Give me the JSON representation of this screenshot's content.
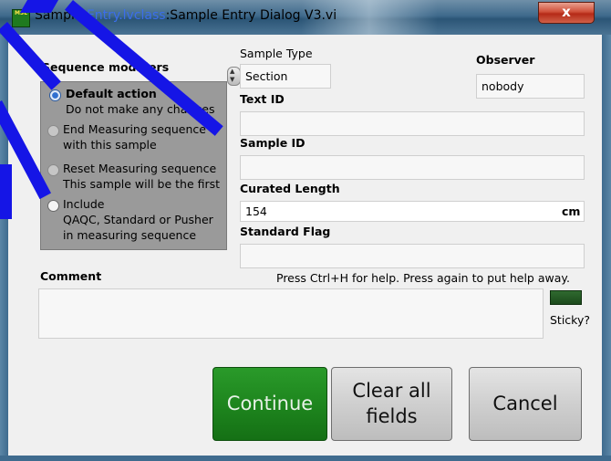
{
  "window": {
    "title_part1": "Sample ",
    "title_part2": "Entry.lvclass",
    "title_part3": ":Sample Entry Dialog V3.vi",
    "icon_label": "MSL",
    "close_symbol": "x"
  },
  "sequence_modifiers": {
    "title": "Sequence modifiers",
    "options": [
      {
        "line1": "Default action",
        "line2": "Do not make any changes",
        "selected": true
      },
      {
        "line1": "End Measuring sequence",
        "line2": "with this sample",
        "selected": false
      },
      {
        "line1": "Reset Measuring sequence",
        "line2": "This sample will be the first",
        "selected": false
      },
      {
        "line1": "Include",
        "line2": "QAQC, Standard or Pusher",
        "line3": "in measuring sequence",
        "selected": false
      }
    ]
  },
  "sample_type": {
    "label": "Sample Type",
    "value": "Section"
  },
  "observer": {
    "label": "Observer",
    "value": "nobody"
  },
  "text_id": {
    "label": "Text ID",
    "value": ""
  },
  "sample_id": {
    "label": "Sample ID",
    "value": ""
  },
  "curated_length": {
    "label": "Curated Length",
    "value": "154",
    "unit": "cm"
  },
  "standard_flag": {
    "label": "Standard Flag",
    "value": ""
  },
  "help_text": "Press Ctrl+H for help. Press again to put help away.",
  "comment": {
    "label": "Comment",
    "value": ""
  },
  "sticky": {
    "label": "Sticky?"
  },
  "buttons": {
    "continue": "Continue",
    "clear_line1": "Clear all",
    "clear_line2": "fields",
    "cancel": "Cancel"
  },
  "colors": {
    "overlay_stroke": "#1515e6",
    "continue_green": "#1e861e",
    "group_gray": "#9a9a9a"
  }
}
